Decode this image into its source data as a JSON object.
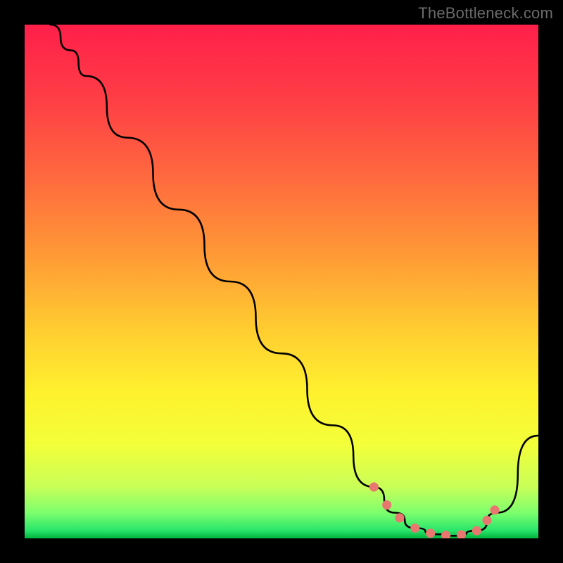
{
  "watermark": "TheBottleneck.com",
  "chart_data": {
    "type": "line",
    "title": "",
    "xlabel": "",
    "ylabel": "",
    "xlim": [
      0,
      100
    ],
    "ylim": [
      0,
      100
    ],
    "series": [
      {
        "name": "curve",
        "x": [
          5,
          9,
          12,
          20,
          30,
          40,
          50,
          60,
          68,
          72,
          76,
          80,
          84,
          88,
          92,
          100
        ],
        "values": [
          100,
          95,
          90,
          78,
          64,
          50,
          36,
          22,
          10,
          5,
          2,
          0.8,
          0.5,
          1.5,
          5,
          20
        ]
      }
    ],
    "markers": {
      "name": "highlight-dots",
      "color": "#e8776f",
      "x": [
        68,
        70.5,
        73,
        76,
        79,
        82,
        85,
        88,
        90,
        91.5
      ],
      "values": [
        10,
        6.5,
        4,
        2,
        1,
        0.6,
        0.7,
        1.5,
        3.5,
        5.5
      ]
    },
    "background_gradient": {
      "top": "#ff1f4a",
      "stops": [
        {
          "offset": 0.0,
          "color": "#ff1f4a"
        },
        {
          "offset": 0.15,
          "color": "#ff3f46"
        },
        {
          "offset": 0.3,
          "color": "#ff6a3e"
        },
        {
          "offset": 0.45,
          "color": "#ff9a36"
        },
        {
          "offset": 0.6,
          "color": "#ffcf30"
        },
        {
          "offset": 0.72,
          "color": "#fff22e"
        },
        {
          "offset": 0.82,
          "color": "#f2ff3a"
        },
        {
          "offset": 0.9,
          "color": "#c8ff58"
        },
        {
          "offset": 0.95,
          "color": "#7dff6e"
        },
        {
          "offset": 0.985,
          "color": "#28e56a"
        },
        {
          "offset": 1.0,
          "color": "#00b33c"
        }
      ]
    }
  }
}
